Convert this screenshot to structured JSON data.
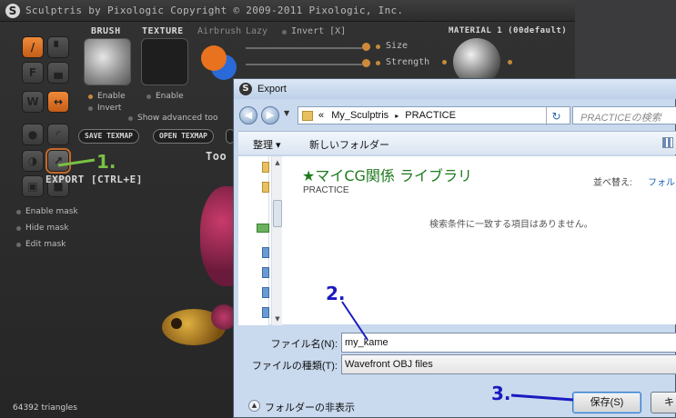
{
  "sculptris": {
    "title": "Sculptris by Pixologic    Copyright © 2009-2011 Pixologic, Inc.",
    "labels": {
      "brush": "BRUSH",
      "texture": "TEXTURE",
      "airbrush": "Airbrush",
      "lazy": "Lazy",
      "invert_x": "Invert [X]",
      "size": "Size",
      "strength": "Strength",
      "material": "MATERIAL 1 (00default)"
    },
    "brush_options": {
      "enable": "Enable",
      "invert": "Invert"
    },
    "texture_options": {
      "enable": "Enable"
    },
    "show_advanced": "Show advanced too",
    "buttons": {
      "save_texmap": "SAVE TEXMAP",
      "open_texmap": "OPEN TEXMAP"
    },
    "tools_fragment": "Too",
    "export_label": "EXPORT [CTRL+E]",
    "mask": {
      "enable": "Enable mask",
      "hide": "Hide mask",
      "edit": "Edit mask"
    },
    "triangles": "64392 triangles",
    "tool_icons": [
      "draw-icon",
      "flatten-icon",
      "fill-icon",
      "crease-icon",
      "wave-icon",
      "move-icon",
      "sphere-icon",
      "smooth-icon",
      "obj-icon",
      "export-icon",
      "lock-icon",
      "trash-icon"
    ]
  },
  "dialog": {
    "title": "Export",
    "breadcrumb": [
      "«",
      "My_Sculptris",
      "▸",
      "PRACTICE"
    ],
    "search_placeholder": "PRACTICEの検索",
    "toolbar": {
      "organize": "整理 ▾",
      "new_folder": "新しいフォルダー"
    },
    "library_title": "★マイCG関係 ライブラリ",
    "library_sub": "PRACTICE",
    "sort_label": "並べ替え:",
    "sort_value": "フォル",
    "empty_message": "検索条件に一致する項目はありません。",
    "filename_label": "ファイル名(N):",
    "filename_value": "my_kame",
    "filetype_label": "ファイルの種類(T):",
    "filetype_value": "Wavefront OBJ files",
    "hide_folders": "フォルダーの非表示",
    "save_button": "保存(S)",
    "cancel_button": "キ"
  },
  "annotations": [
    {
      "text": "1.",
      "color": "#7ac143"
    },
    {
      "text": "2.",
      "color": "#1a1ac0"
    },
    {
      "text": "3.",
      "color": "#1a1ac0"
    }
  ]
}
